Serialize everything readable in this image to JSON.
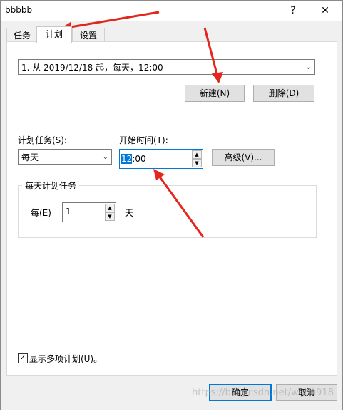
{
  "window": {
    "title": "bbbbb",
    "help_label": "?",
    "close_label": "✕"
  },
  "tabs": [
    {
      "label": "任务"
    },
    {
      "label": "计划"
    },
    {
      "label": "设置"
    }
  ],
  "schedule": {
    "selected": "1. 从 2019/12/18 起，每天，12:00",
    "new_label": "新建(N)",
    "delete_label": "删除(D)"
  },
  "task": {
    "label": "计划任务(S):",
    "value": "每天"
  },
  "start_time": {
    "label": "开始时间(T):",
    "hour": "12",
    "rest": ":00",
    "advanced_label": "高级(V)..."
  },
  "daily": {
    "group_title": "每天计划任务",
    "every_label": "每(E)",
    "value": "1",
    "unit": "天"
  },
  "show_multiple": {
    "label": "显示多项计划(U)。",
    "checked": true
  },
  "footer": {
    "ok_label": "确定",
    "cancel_label": "取消"
  },
  "watermark": "https://blog.csdn.net/wohu918",
  "colors": {
    "accent": "#0078d7",
    "annotation": "#e3261e"
  }
}
